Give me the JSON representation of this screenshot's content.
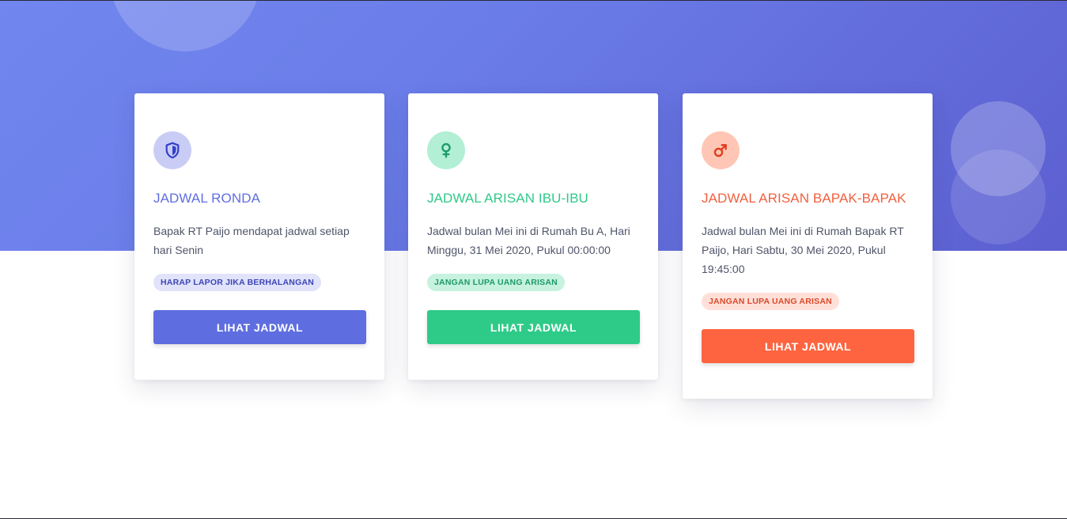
{
  "cards": [
    {
      "title": "JADWAL RONDA",
      "description": "Bapak RT Paijo mendapat jadwal setiap hari Senin",
      "badge": "HARAP LAPOR JIKA BERHALANGAN",
      "button_label": "LIHAT JADWAL",
      "icon": "shield-icon",
      "accent_color": "#5f6ee0"
    },
    {
      "title": "JADWAL ARISAN IBU-IBU",
      "description": "Jadwal bulan Mei ini di Rumah Bu A, Hari Minggu, 31 Mei 2020, Pukul 00:00:00",
      "badge": "JANGAN LUPA UANG ARISAN",
      "button_label": "LIHAT JADWAL",
      "icon": "female-icon",
      "accent_color": "#2ecb88"
    },
    {
      "title": "JADWAL ARISAN BAPAK-BAPAK",
      "description": "Jadwal bulan Mei ini di Rumah Bapak RT Paijo, Hari Sabtu, 30 Mei 2020, Pukul 19:45:00",
      "badge": "JANGAN LUPA UANG ARISAN",
      "button_label": "LIHAT JADWAL",
      "icon": "male-icon",
      "accent_color": "#ff6440"
    }
  ],
  "hero_gradient": [
    "#7186ef",
    "#5c5fd0"
  ]
}
